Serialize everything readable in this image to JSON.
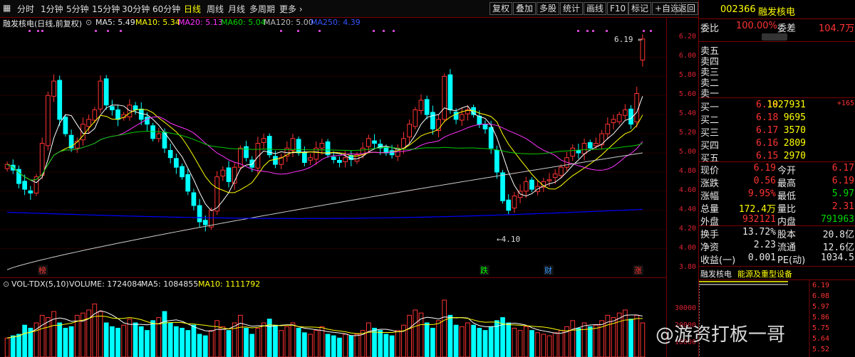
{
  "toolbar": {
    "periods": [
      "分时",
      "1分钟",
      "5分钟",
      "15分钟",
      "30分钟",
      "60分钟",
      "日线",
      "周线",
      "月线",
      "多周期",
      "更多 ›"
    ],
    "active": "日线",
    "tools": [
      "复权",
      "叠加",
      "多股",
      "统计",
      "画线",
      "F10",
      "标记",
      "+自选",
      "返回"
    ]
  },
  "title": {
    "name": "融发核电(日线,前复权)",
    "ma5": "MA5: 5.49",
    "ma10": "MA10: 5.34",
    "ma20": "MA20: 5.13",
    "ma60": "MA60: 5.04",
    "ma120": "MA120: 5.00",
    "ma250": "MA250: 4.39"
  },
  "colors": {
    "up": "#ff3333",
    "down": "#00ffff",
    "ma5": "#ffffff",
    "ma10": "#ffff00",
    "ma20": "#ff33ff",
    "ma60": "#00cc00",
    "ma120": "#cccccc",
    "ma250": "#0000ff"
  },
  "chart_data": {
    "type": "candlestick",
    "ylim": [
      3.7,
      6.3
    ],
    "close": [
      4.88,
      4.82,
      4.68,
      4.62,
      4.58,
      4.75,
      5.1,
      5.6,
      5.75,
      5.35,
      5.2,
      5.05,
      5.12,
      5.3,
      5.35,
      5.45,
      5.75,
      5.5,
      5.45,
      5.35,
      5.4,
      5.5,
      5.45,
      5.35,
      5.3,
      5.15,
      5.2,
      5.05,
      4.95,
      4.85,
      4.75,
      4.6,
      4.45,
      4.28,
      4.25,
      4.4,
      4.75,
      4.82,
      4.7,
      4.85,
      5.05,
      4.95,
      4.85,
      5.1,
      5.15,
      4.98,
      4.88,
      4.95,
      5.05,
      5.15,
      5.0,
      4.9,
      4.95,
      5.05,
      5.1,
      4.98,
      4.93,
      4.9,
      4.95,
      4.93,
      4.98,
      5.05,
      5.15,
      5.1,
      5.05,
      5.0,
      4.98,
      5.05,
      5.15,
      5.3,
      5.45,
      5.55,
      5.4,
      5.25,
      5.35,
      5.8,
      5.45,
      5.35,
      5.4,
      5.45,
      5.4,
      5.3,
      5.25,
      5.05,
      4.8,
      4.5,
      4.4,
      4.55,
      4.6,
      4.7,
      4.62,
      4.65,
      4.7,
      4.72,
      4.78,
      4.85,
      4.95,
      5.05,
      5.0,
      5.1,
      5.05,
      5.1,
      5.2,
      5.3,
      5.35,
      5.4,
      5.45,
      5.3,
      5.62,
      6.19
    ],
    "ma250_end": 4.39,
    "markers": [
      "榜",
      "跌",
      "财",
      "涨"
    ],
    "annotations": {
      "high": "6.19",
      "low": "4.10"
    },
    "volume": [
      25000,
      28000,
      30000,
      42000,
      38000,
      45000,
      55000,
      52000,
      60000,
      45000,
      38000,
      40000,
      55000,
      58000,
      62000,
      70000,
      60000,
      45000,
      40000,
      38000,
      42000,
      50000,
      45000,
      40000,
      35000,
      48000,
      52000,
      60000,
      45000,
      40000,
      38000,
      35000,
      42000,
      30000,
      28000,
      35000,
      48000,
      40000,
      35000,
      45000,
      55000,
      38000,
      30000,
      38000,
      45000,
      50000,
      42000,
      35000,
      40000,
      45000,
      38000,
      32000,
      30000,
      35000,
      40000,
      30000,
      28000,
      25000,
      30000,
      28000,
      30000,
      35000,
      45000,
      38000,
      35000,
      30000,
      28000,
      35000,
      42000,
      55000,
      62000,
      58000,
      45000,
      38000,
      48000,
      75000,
      55000,
      42000,
      40000,
      45000,
      42000,
      38000,
      35000,
      40000,
      48000,
      52000,
      45000,
      38000,
      35000,
      40000,
      35000,
      32000,
      30000,
      28000,
      32000,
      35000,
      40000,
      48000,
      38000,
      45000,
      40000,
      42000,
      48000,
      55000,
      52000,
      58000,
      62000,
      50000,
      55000,
      45000
    ]
  },
  "price_axis": [
    "6.20",
    "6.00",
    "5.80",
    "5.60",
    "5.40",
    "5.20",
    "5.00",
    "4.80",
    "4.60",
    "4.40",
    "4.20",
    "4.00",
    "3.80"
  ],
  "vol_header": {
    "name": "VOL-TDX(5,10)",
    "volume": "VOLUME: 1724084",
    "ma5": "MA5: 1084855",
    "ma10": "MA10: 1111792"
  },
  "vol_axis": [
    "30000",
    "20000",
    "10000"
  ],
  "panel": {
    "code": "002366",
    "name": "融发核电",
    "weibi_label": "委比",
    "weibi_val": "100.00%",
    "weicha_label": "委差",
    "weicha_val": "104.7万",
    "sells": [
      "卖五",
      "卖四",
      "卖三",
      "卖二",
      "卖一"
    ],
    "buys": [
      {
        "label": "买一",
        "price": "6.19",
        "vol": "1027931",
        "chg": "+165"
      },
      {
        "label": "买二",
        "price": "6.18",
        "vol": "9695",
        "chg": ""
      },
      {
        "label": "买三",
        "price": "6.17",
        "vol": "3570",
        "chg": ""
      },
      {
        "label": "买四",
        "price": "6.16",
        "vol": "2809",
        "chg": ""
      },
      {
        "label": "买五",
        "price": "6.15",
        "vol": "2970",
        "chg": ""
      }
    ],
    "stats": [
      {
        "l1": "现价",
        "v1": "6.19",
        "l2": "今开",
        "v2": "6.17"
      },
      {
        "l1": "涨跌",
        "v1": "0.56",
        "l2": "最高",
        "v2": "6.19"
      },
      {
        "l1": "涨幅",
        "v1": "9.95%",
        "l2": "最低",
        "v2": "5.97"
      },
      {
        "l1": "总量",
        "v1": "172.4万",
        "l2": "量比",
        "v2": "2.31"
      },
      {
        "l1": "外盘",
        "v1": "932121",
        "l2": "内盘",
        "v2": "791963"
      }
    ],
    "stats2": [
      {
        "l1": "换手",
        "v1": "13.72%",
        "l2": "股本",
        "v2": "20.8亿"
      },
      {
        "l1": "净资",
        "v1": "2.23",
        "l2": "流通",
        "v2": "12.6亿"
      },
      {
        "l1": "收益(一)",
        "v1": "0.001",
        "l2": "PE(动)",
        "v2": "1034.5"
      }
    ],
    "tabs": [
      "融发核电",
      "能源及重型设备"
    ],
    "mini_axis": [
      "6.19",
      "6.08",
      "5.97",
      "5.86",
      "5.75",
      "5.64",
      "5.52"
    ]
  },
  "watermark": "@游资打板一哥"
}
